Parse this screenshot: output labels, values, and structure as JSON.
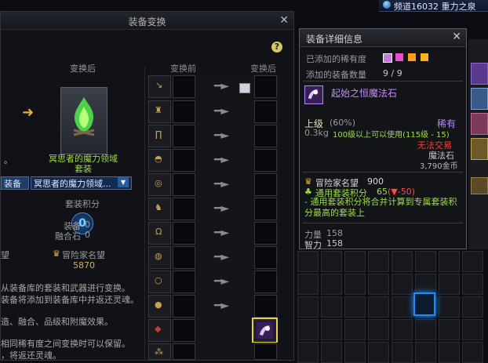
{
  "topbar": {
    "channel": "频道16032 重力之泉"
  },
  "main": {
    "title": "装备变换",
    "help": "?",
    "close": "✕",
    "after_label": "变换后",
    "before_header": "变换前",
    "after_header": "变换后",
    "set_name_line1": "冥思者的魔力领域",
    "set_name_line2": "套装",
    "left_dot": "。",
    "selector_left": "装备",
    "selector_main": "冥思者的魔力领域...",
    "score_label": "套装积分",
    "score_value": "0",
    "equip_label": "装备",
    "equip_value": "0",
    "fusion_label": "融合石",
    "fusion_value": "0",
    "left_frag": "望",
    "fame_label": "冒险家名望",
    "fame_value": "5870",
    "desc_1": "从装备库的套装和武器进行变换。",
    "desc_2": "装备将添加到装备库中并返还灵魂。",
    "desc_3": "造、融合、品级和附魔效果。",
    "desc_4": "相同稀有度之间变换时可以保留。",
    "desc_5": "，将返还灵魂。"
  },
  "tooltip": {
    "title": "装备详细信息",
    "close": "✕",
    "added_rarity_label": "已添加的稀有度",
    "added_count_label": "添加的装备数量",
    "added_count_value": "9 / 9",
    "rarity_colors": [
      "#c678dd",
      "#e84dd8",
      "#ff9a1a",
      "#ffb020"
    ],
    "item_name": "起始之恒魔法石",
    "grade": "上级",
    "grade_pct": "(60%)",
    "rarity": "稀有",
    "weight": "0.3kg",
    "level_req": "100级以上可以使用(115级 - 15)",
    "trade": "无法交易",
    "type": "魔法石",
    "price": "3,790金币",
    "fame_label": "冒险家名望",
    "fame_value": "900",
    "set_score_label": "通用套装积分",
    "set_score_value": "65",
    "set_score_delta": "(▼-50)",
    "note": "- 通用套装积分将合并计算到专属套装积分最高的套装上",
    "stat1_label": "力量",
    "stat1_value": "158",
    "stat2_label": "智力",
    "stat2_value": "158"
  },
  "colors": {
    "accent_gold": "#d6b24a",
    "set_green": "#9fdc4a",
    "select_blue": "#1a8dff"
  }
}
